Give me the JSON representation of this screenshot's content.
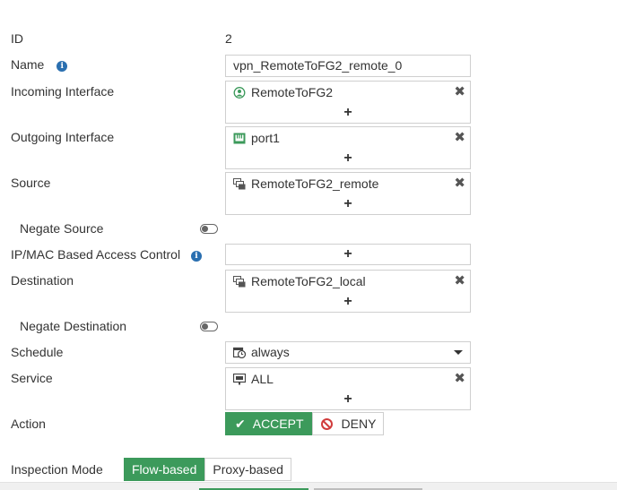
{
  "form": {
    "id_label": "ID",
    "id_value": "2",
    "name_label": "Name",
    "name_value": "vpn_RemoteToFG2_remote_0",
    "incoming_label": "Incoming Interface",
    "incoming_items": [
      {
        "label": "RemoteToFG2",
        "icon": "tunnel-icon"
      }
    ],
    "outgoing_label": "Outgoing Interface",
    "outgoing_items": [
      {
        "label": "port1",
        "icon": "port-icon"
      }
    ],
    "source_label": "Source",
    "source_items": [
      {
        "label": "RemoteToFG2_remote",
        "icon": "address-icon"
      }
    ],
    "negate_source_label": "Negate Source",
    "ipmac_label": "IP/MAC Based Access Control",
    "destination_label": "Destination",
    "destination_items": [
      {
        "label": "RemoteToFG2_local",
        "icon": "address-icon"
      }
    ],
    "negate_destination_label": "Negate Destination",
    "schedule_label": "Schedule",
    "schedule_value": "always",
    "service_label": "Service",
    "service_items": [
      {
        "label": "ALL",
        "icon": "service-icon"
      }
    ],
    "action_label": "Action",
    "action_accept": "ACCEPT",
    "action_deny": "DENY",
    "inspection_label": "Inspection Mode",
    "inspection_flow": "Flow-based",
    "inspection_proxy": "Proxy-based",
    "add_symbol": "+",
    "remove_symbol": "✖",
    "info_symbol": "i"
  },
  "colors": {
    "accent_green": "#3c9a5b",
    "deny_red": "#d13c3c",
    "info_blue": "#2a6fb0"
  }
}
